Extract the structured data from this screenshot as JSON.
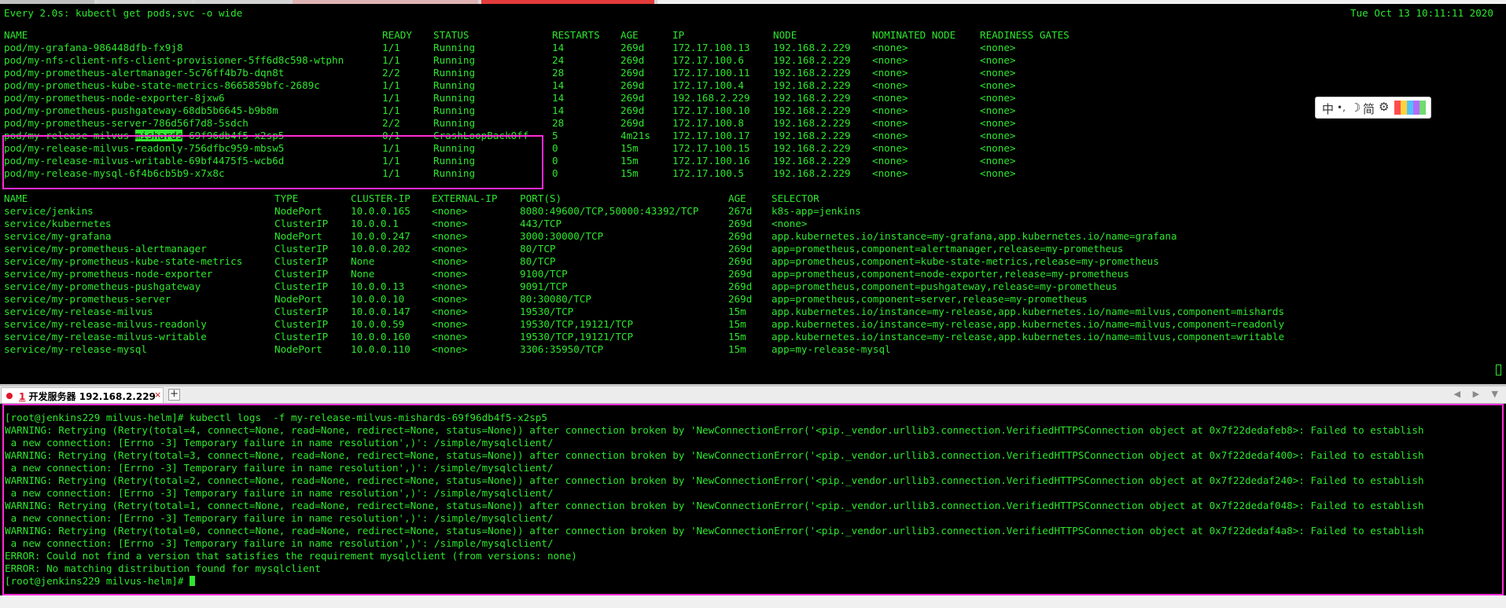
{
  "header_left": "Every 2.0s: kubectl get pods,svc -o wide",
  "header_right": "Tue Oct 13 10:11:11 2020",
  "pods_header": [
    "NAME",
    "READY",
    "STATUS",
    "RESTARTS",
    "AGE",
    "IP",
    "NODE",
    "NOMINATED NODE",
    "READINESS GATES"
  ],
  "pods": [
    [
      "pod/my-grafana-986448dfb-fx9j8",
      "1/1",
      "Running",
      "14",
      "269d",
      "172.17.100.13",
      "192.168.2.229",
      "<none>",
      "<none>"
    ],
    [
      "pod/my-nfs-client-nfs-client-provisioner-5ff6d8c598-wtphn",
      "1/1",
      "Running",
      "24",
      "269d",
      "172.17.100.6",
      "192.168.2.229",
      "<none>",
      "<none>"
    ],
    [
      "pod/my-prometheus-alertmanager-5c76ff4b7b-dqn8t",
      "2/2",
      "Running",
      "28",
      "269d",
      "172.17.100.11",
      "192.168.2.229",
      "<none>",
      "<none>"
    ],
    [
      "pod/my-prometheus-kube-state-metrics-8665859bfc-2689c",
      "1/1",
      "Running",
      "14",
      "269d",
      "172.17.100.4",
      "192.168.2.229",
      "<none>",
      "<none>"
    ],
    [
      "pod/my-prometheus-node-exporter-8jxw6",
      "1/1",
      "Running",
      "14",
      "269d",
      "192.168.2.229",
      "192.168.2.229",
      "<none>",
      "<none>"
    ],
    [
      "pod/my-prometheus-pushgateway-68db5b6645-b9b8m",
      "1/1",
      "Running",
      "14",
      "269d",
      "172.17.100.10",
      "192.168.2.229",
      "<none>",
      "<none>"
    ],
    [
      "pod/my-prometheus-server-786d56f7d8-5sdch",
      "2/2",
      "Running",
      "28",
      "269d",
      "172.17.100.8",
      "192.168.2.229",
      "<none>",
      "<none>"
    ],
    [
      "pod/my-release-milvus-mishards-69f96db4f5-x2sp5",
      "0/1",
      "CrashLoopBackOff",
      "5",
      "4m21s",
      "172.17.100.17",
      "192.168.2.229",
      "<none>",
      "<none>"
    ],
    [
      "pod/my-release-milvus-readonly-756dfbc959-mbsw5",
      "1/1",
      "Running",
      "0",
      "15m",
      "172.17.100.15",
      "192.168.2.229",
      "<none>",
      "<none>"
    ],
    [
      "pod/my-release-milvus-writable-69bf4475f5-wcb6d",
      "1/1",
      "Running",
      "0",
      "15m",
      "172.17.100.16",
      "192.168.2.229",
      "<none>",
      "<none>"
    ],
    [
      "pod/my-release-mysql-6f4b6cb5b9-x7x8c",
      "1/1",
      "Running",
      "0",
      "15m",
      "172.17.100.5",
      "192.168.2.229",
      "<none>",
      "<none>"
    ]
  ],
  "highlight_word": {
    "prefix": "pod/my-release-milvus-",
    "word": "mishards",
    "suffix": "-69f96db4f5-x2sp5"
  },
  "svc_header": [
    "NAME",
    "TYPE",
    "CLUSTER-IP",
    "EXTERNAL-IP",
    "PORT(S)",
    "AGE",
    "SELECTOR"
  ],
  "services": [
    [
      "service/jenkins",
      "NodePort",
      "10.0.0.165",
      "<none>",
      "8080:49600/TCP,50000:43392/TCP",
      "267d",
      "k8s-app=jenkins"
    ],
    [
      "service/kubernetes",
      "ClusterIP",
      "10.0.0.1",
      "<none>",
      "443/TCP",
      "269d",
      "<none>"
    ],
    [
      "service/my-grafana",
      "NodePort",
      "10.0.0.247",
      "<none>",
      "3000:30000/TCP",
      "269d",
      "app.kubernetes.io/instance=my-grafana,app.kubernetes.io/name=grafana"
    ],
    [
      "service/my-prometheus-alertmanager",
      "ClusterIP",
      "10.0.0.202",
      "<none>",
      "80/TCP",
      "269d",
      "app=prometheus,component=alertmanager,release=my-prometheus"
    ],
    [
      "service/my-prometheus-kube-state-metrics",
      "ClusterIP",
      "None",
      "<none>",
      "80/TCP",
      "269d",
      "app=prometheus,component=kube-state-metrics,release=my-prometheus"
    ],
    [
      "service/my-prometheus-node-exporter",
      "ClusterIP",
      "None",
      "<none>",
      "9100/TCP",
      "269d",
      "app=prometheus,component=node-exporter,release=my-prometheus"
    ],
    [
      "service/my-prometheus-pushgateway",
      "ClusterIP",
      "10.0.0.13",
      "<none>",
      "9091/TCP",
      "269d",
      "app=prometheus,component=pushgateway,release=my-prometheus"
    ],
    [
      "service/my-prometheus-server",
      "NodePort",
      "10.0.0.10",
      "<none>",
      "80:30080/TCP",
      "269d",
      "app=prometheus,component=server,release=my-prometheus"
    ],
    [
      "service/my-release-milvus",
      "ClusterIP",
      "10.0.0.147",
      "<none>",
      "19530/TCP",
      "15m",
      "app.kubernetes.io/instance=my-release,app.kubernetes.io/name=milvus,component=mishards"
    ],
    [
      "service/my-release-milvus-readonly",
      "ClusterIP",
      "10.0.0.59",
      "<none>",
      "19530/TCP,19121/TCP",
      "15m",
      "app.kubernetes.io/instance=my-release,app.kubernetes.io/name=milvus,component=readonly"
    ],
    [
      "service/my-release-milvus-writable",
      "ClusterIP",
      "10.0.0.160",
      "<none>",
      "19530/TCP,19121/TCP",
      "15m",
      "app.kubernetes.io/instance=my-release,app.kubernetes.io/name=milvus,component=writable"
    ],
    [
      "service/my-release-mysql",
      "NodePort",
      "10.0.0.110",
      "<none>",
      "3306:35950/TCP",
      "15m",
      "app=my-release-mysql"
    ]
  ],
  "ime": {
    "zh": "中",
    "punct": "•,",
    "moon": "☽",
    "simplified": "简",
    "gear": "⚙"
  },
  "session_tab": {
    "number": "1",
    "label": "开发服务器 192.168.2.229",
    "close": "×",
    "add": "+"
  },
  "tab_nav": "◀ ▶ ▼",
  "log_lines": [
    "[root@jenkins229 milvus-helm]# kubectl logs  -f my-release-milvus-mishards-69f96db4f5-x2sp5",
    "WARNING: Retrying (Retry(total=4, connect=None, read=None, redirect=None, status=None)) after connection broken by 'NewConnectionError('<pip._vendor.urllib3.connection.VerifiedHTTPSConnection object at 0x7f22dedafeb8>: Failed to establish",
    " a new connection: [Errno -3] Temporary failure in name resolution',)': /simple/mysqlclient/",
    "WARNING: Retrying (Retry(total=3, connect=None, read=None, redirect=None, status=None)) after connection broken by 'NewConnectionError('<pip._vendor.urllib3.connection.VerifiedHTTPSConnection object at 0x7f22dedaf400>: Failed to establish",
    " a new connection: [Errno -3] Temporary failure in name resolution',)': /simple/mysqlclient/",
    "WARNING: Retrying (Retry(total=2, connect=None, read=None, redirect=None, status=None)) after connection broken by 'NewConnectionError('<pip._vendor.urllib3.connection.VerifiedHTTPSConnection object at 0x7f22dedaf240>: Failed to establish",
    " a new connection: [Errno -3] Temporary failure in name resolution',)': /simple/mysqlclient/",
    "WARNING: Retrying (Retry(total=1, connect=None, read=None, redirect=None, status=None)) after connection broken by 'NewConnectionError('<pip._vendor.urllib3.connection.VerifiedHTTPSConnection object at 0x7f22dedaf048>: Failed to establish",
    " a new connection: [Errno -3] Temporary failure in name resolution',)': /simple/mysqlclient/",
    "WARNING: Retrying (Retry(total=0, connect=None, read=None, redirect=None, status=None)) after connection broken by 'NewConnectionError('<pip._vendor.urllib3.connection.VerifiedHTTPSConnection object at 0x7f22dedaf4a8>: Failed to establish",
    " a new connection: [Errno -3] Temporary failure in name resolution',)': /simple/mysqlclient/",
    "ERROR: Could not find a version that satisfies the requirement mysqlclient (from versions: none)",
    "ERROR: No matching distribution found for mysqlclient"
  ],
  "prompt": "[root@jenkins229 milvus-helm]# ",
  "colors": {
    "terminal_text": "#2ee62e",
    "background": "#000000",
    "highlight_border": "#ff2bd6",
    "selection_bg": "#2ee62e"
  }
}
